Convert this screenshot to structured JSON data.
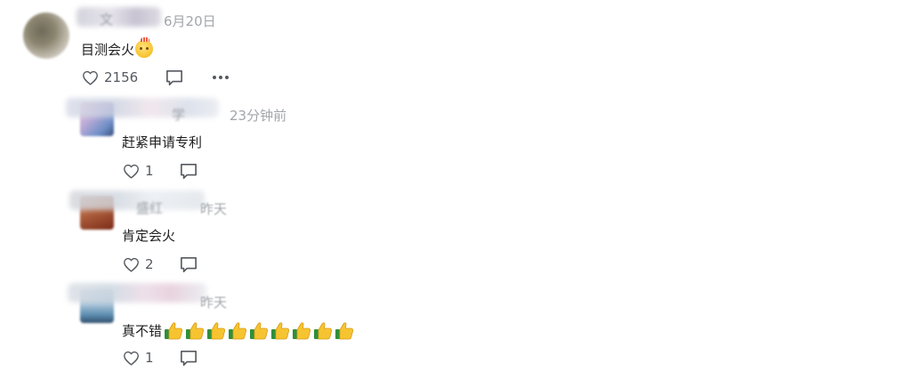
{
  "comments": [
    {
      "time": "6月20日",
      "text": "目测会火",
      "emoji": "face-with-party-hat",
      "likes": "2156",
      "name_fragment": "文"
    }
  ],
  "replies": [
    {
      "time": "23分钟前",
      "text": "赶紧申请专利",
      "likes": "1",
      "name_fragment": "学"
    },
    {
      "time": "昨天",
      "text": "肯定会火",
      "likes": "2",
      "name_fragment": "盛红"
    },
    {
      "time": "昨天",
      "text": "真不错",
      "likes": "1",
      "thumbs_up_count": 9,
      "name_fragment": ""
    }
  ],
  "icons": {
    "like": "heart-outline-icon",
    "reply": "comment-bubble-icon",
    "more": "more-dots-icon",
    "thumbs": "thumbs-up-emoji"
  },
  "colors": {
    "text": "#1f1f1f",
    "muted": "#a2a6ab",
    "icon": "#555a60"
  }
}
